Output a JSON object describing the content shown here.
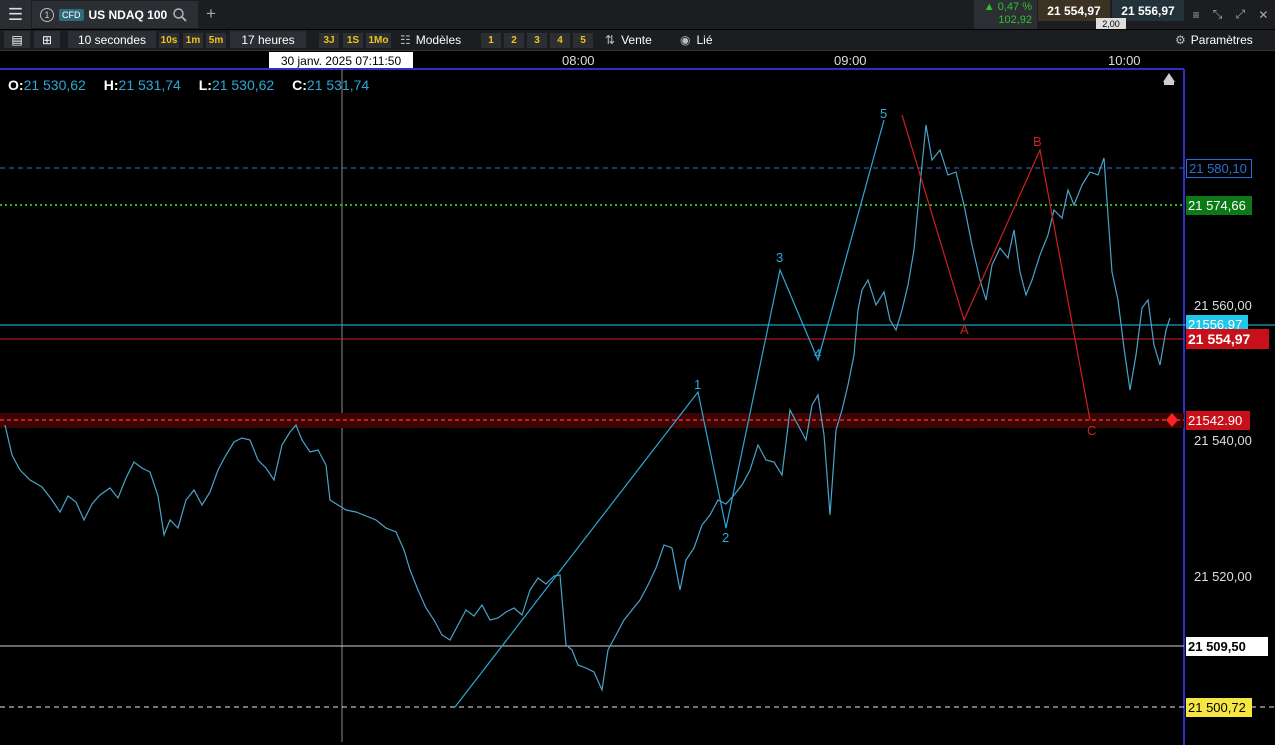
{
  "header": {
    "menu_icon": "hamburger-icon",
    "tab_number": "1",
    "tab_badge": "CFD",
    "instrument": "US NDAQ 100",
    "search_icon": "search-icon",
    "add_tab_icon": "plus-icon",
    "change_pct": "▲ 0,47 %",
    "change_abs": "102,92",
    "bid": "21 554,97",
    "ask": "21 556,97",
    "spread": "2,00"
  },
  "toolbar": {
    "interval": "10 secondes",
    "quick_intervals": [
      "10s",
      "1m",
      "5m"
    ],
    "range": "17 heures",
    "quick_ranges": [
      "3J",
      "1S",
      "1Mo"
    ],
    "models": "Modèles",
    "presets": [
      "1",
      "2",
      "3",
      "4",
      "5"
    ],
    "sell": "Vente",
    "linked": "Lié",
    "settings": "Paramètres"
  },
  "time_axis": {
    "crosshair_time": "30 janv. 2025 07:11:50",
    "labels": [
      "08:00",
      "09:00",
      "10:00"
    ]
  },
  "ohlc": {
    "o_label": "O:",
    "o": "21 530,62",
    "h_label": "H:",
    "h": "21 531,74",
    "l_label": "L:",
    "l": "21 530,62",
    "c_label": "C:",
    "c": "21 531,74"
  },
  "price_axis": {
    "ticks": [
      "21 560,00",
      "21 540,00",
      "21 520,00"
    ],
    "levels": [
      {
        "label": "21 580,10",
        "bg": "#000",
        "color": "#2b6fd6"
      },
      {
        "label": "21 574,66",
        "bg": "#0b7a16",
        "color": "#ffffff"
      },
      {
        "label": "21556.97",
        "bg": "#1fc8e8",
        "color": "#ffffff"
      },
      {
        "label": "21 554,97",
        "bg": "#c8101a",
        "color": "#ffffff"
      },
      {
        "label": "21542.90",
        "bg": "#c8101a",
        "color": "#ffffff"
      },
      {
        "label": "21 509,50",
        "bg": "#ffffff",
        "color": "#000000"
      },
      {
        "label": "21 500,72",
        "bg": "#f5e642",
        "color": "#000000"
      }
    ]
  },
  "waves": {
    "impulse": [
      "1",
      "2",
      "3",
      "4",
      "5"
    ],
    "correction": [
      "A",
      "B",
      "C"
    ],
    "impulse_color": "#2ea8d6",
    "correction_color": "#d11f1f"
  },
  "colors": {
    "accent": "#2ea8d6",
    "up": "#2fc22f",
    "sell": "#c8101a"
  }
}
